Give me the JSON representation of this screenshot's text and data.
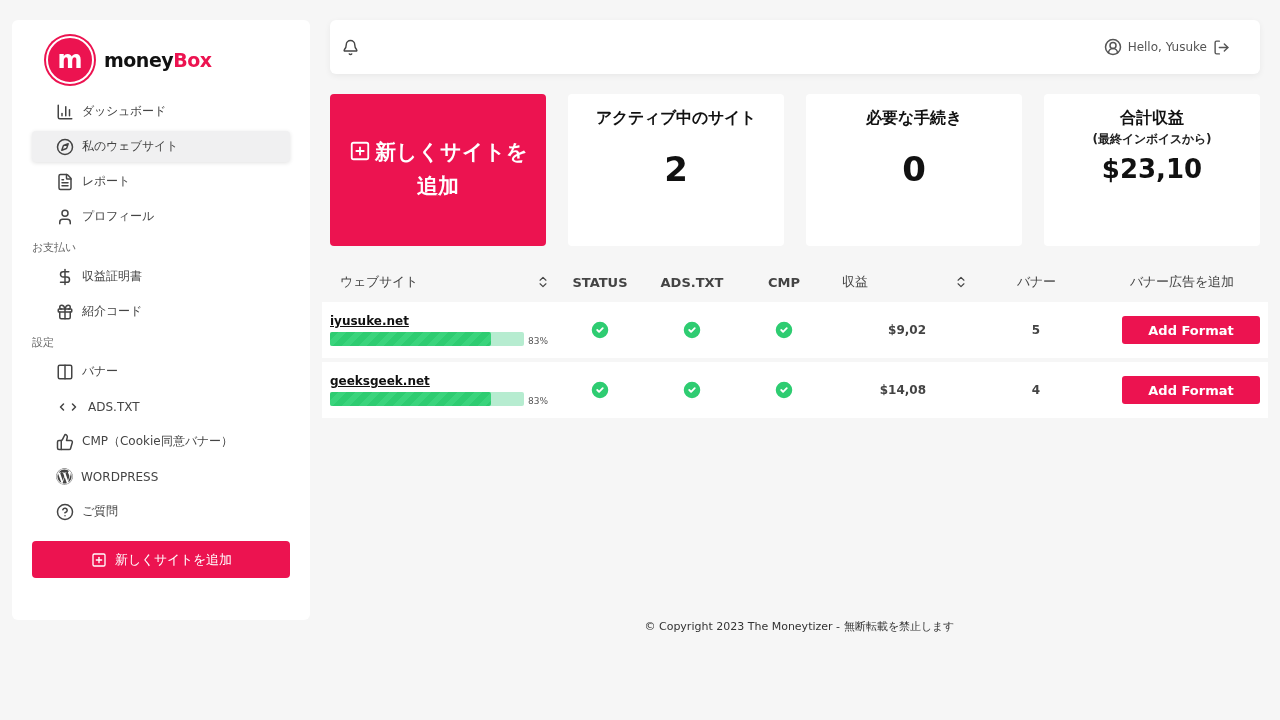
{
  "brand": {
    "mark": "m",
    "text_1": "money",
    "text_2": "Box"
  },
  "sidebar": {
    "sections": [
      {
        "items": [
          {
            "label": "ダッシュボード",
            "selected": false
          },
          {
            "label": "私のウェブサイト",
            "selected": true
          },
          {
            "label": "レポート",
            "selected": false
          },
          {
            "label": "プロフィール",
            "selected": false
          }
        ]
      },
      {
        "heading": "お支払い",
        "items": [
          {
            "label": "収益証明書",
            "selected": false
          },
          {
            "label": "紹介コード",
            "selected": false
          }
        ]
      },
      {
        "heading": "設定",
        "items": [
          {
            "label": "バナー",
            "selected": false
          },
          {
            "label": "ADS.TXT",
            "selected": false
          },
          {
            "label": "CMP（Cookie同意バナー）",
            "selected": false
          },
          {
            "label": "WORDPRESS",
            "selected": false
          },
          {
            "label": "ご質問",
            "selected": false
          }
        ]
      }
    ],
    "add_button": "新しくサイトを追加"
  },
  "topbar": {
    "greeting": "Hello, Yusuke"
  },
  "add_card": "新しくサイトを追加",
  "stats": [
    {
      "title": "アクティブ中のサイト",
      "value": "2"
    },
    {
      "title": "必要な手続き",
      "value": "0"
    },
    {
      "title": "合計収益",
      "subtitle": "(最終インボイスから)",
      "value": "$23,10"
    }
  ],
  "table": {
    "columns": [
      "ウェブサイト",
      "STATUS",
      "ADS.TXT",
      "CMP",
      "収益",
      "バナー",
      "バナー広告を追加"
    ],
    "rows": [
      {
        "site": "iyusuke.net",
        "level": 0.83,
        "reading": "83%",
        "status": true,
        "ads_txt": true,
        "cmp": true,
        "revenue": "$9,02",
        "banners": "5",
        "action": "Add Format"
      },
      {
        "site": "geeksgeek.net",
        "level": 0.83,
        "reading": "83%",
        "status": true,
        "ads_txt": true,
        "cmp": true,
        "revenue": "$14,08",
        "banners": "4",
        "action": "Add Format"
      }
    ]
  },
  "footer": "© Copyright 2023 The Moneytizer - 無断転載を禁止します"
}
